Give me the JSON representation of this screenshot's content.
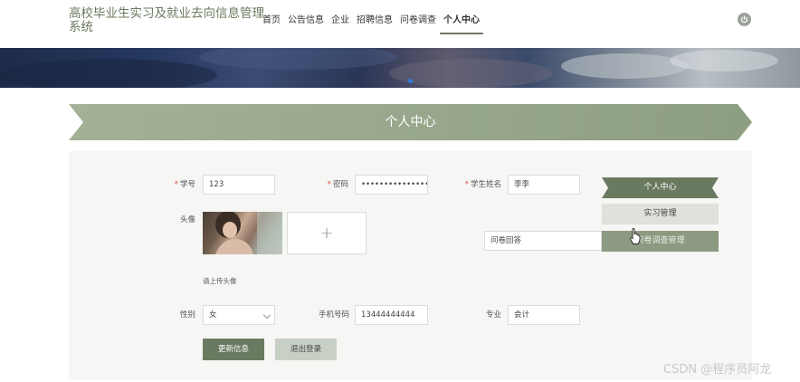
{
  "site": {
    "title": "高校毕业生实习及就业去向信息管理系统"
  },
  "nav": {
    "items": [
      "首页",
      "公告信息",
      "企业",
      "招聘信息",
      "问卷调查",
      "个人中心"
    ],
    "active_index": 5
  },
  "header": {
    "icon": "power-icon"
  },
  "banner": {
    "slide_indicator_color": "#2f7ad8"
  },
  "section": {
    "title": "个人中心"
  },
  "form": {
    "student_id": {
      "label": "学号",
      "value": "123",
      "required": true
    },
    "password": {
      "label": "密码",
      "value": "••••••••••••••••••••••••",
      "required": true
    },
    "student_name": {
      "label": "学生姓名",
      "value": "李李",
      "required": true
    },
    "avatar": {
      "label": "头像",
      "upload_icon": "+",
      "hint": "请上传头像"
    },
    "gender": {
      "label": "性别",
      "value": "女"
    },
    "phone": {
      "label": "手机号码",
      "value": "13444444444"
    },
    "major": {
      "label": "专业",
      "value": "会计"
    }
  },
  "floating_input": {
    "value": "问卷回答"
  },
  "buttons": {
    "update": "更新信息",
    "logout": "退出登录"
  },
  "side_menu": {
    "items": [
      "个人中心",
      "实习管理",
      "问卷调查管理"
    ],
    "active_index": 0
  },
  "watermark": {
    "text": "CSDN @程序员阿龙"
  },
  "colors": {
    "accent": "#6a7a61",
    "banner_green": "#a3b196",
    "title_green": "#6b7a5e",
    "required": "#e05050"
  }
}
